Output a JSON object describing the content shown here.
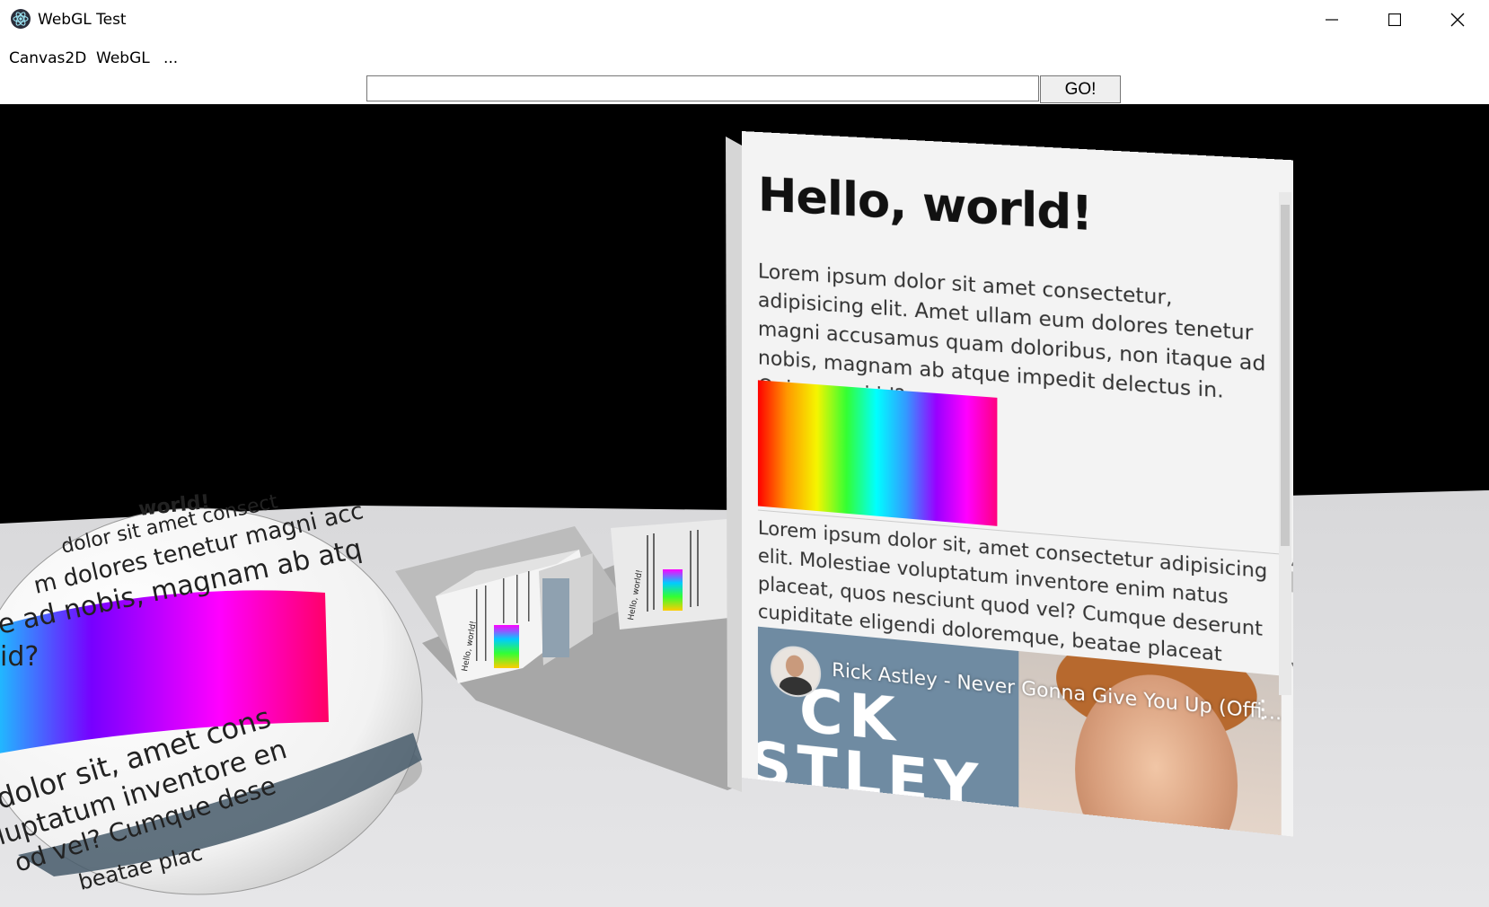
{
  "window": {
    "title": "WebGL Test",
    "controls": {
      "minimize": "—",
      "maximize": "☐",
      "close": "✕"
    }
  },
  "menu": {
    "items": [
      "Canvas2D",
      "WebGL",
      "..."
    ]
  },
  "addressbar": {
    "value": "",
    "placeholder": "",
    "go_label": "GO!"
  },
  "scene": {
    "panel": {
      "heading": "Hello, world!",
      "paragraph1": "Lorem ipsum dolor sit amet consectetur, adipisicing elit. Amet ullam eum dolores tenetur magni accusamus quam doloribus, non itaque ad nobis, magnam ab atque impedit delectus in. Quia, quasi id?",
      "paragraph2": "Lorem ipsum dolor sit, amet consectetur adipisicing elit. Molestiae voluptatum inventore enim natus placeat, quos nesciunt quod vel? Cumque deserunt cupiditate eligendi doloremque, beatae placeat facere rerum corrupti odio",
      "video_title": "Rick Astley - Never Gonna Give You Up (Offi...",
      "video_bg_text_line1": "CK",
      "video_bg_text_line2": "STLEY"
    },
    "sphere_text": {
      "line1": "world!",
      "line2": "dolor sit amet consect",
      "line3": "m dolores tenetur magni acc",
      "line4": "e ad nobis, magnam ab atq",
      "line5": "id?",
      "line6": "dolor sit, amet cons",
      "line7": "luptatum inventore en",
      "line8": "od vel? Cumque dese",
      "line9": "beatae plac"
    },
    "cube_text": "Hello, world!",
    "card_text": "Hello, world!",
    "colors": {
      "background": "#000000",
      "floor": "#e4e4e6",
      "panel": "#f3f3f3",
      "shadow": "#9b9b9b"
    }
  }
}
